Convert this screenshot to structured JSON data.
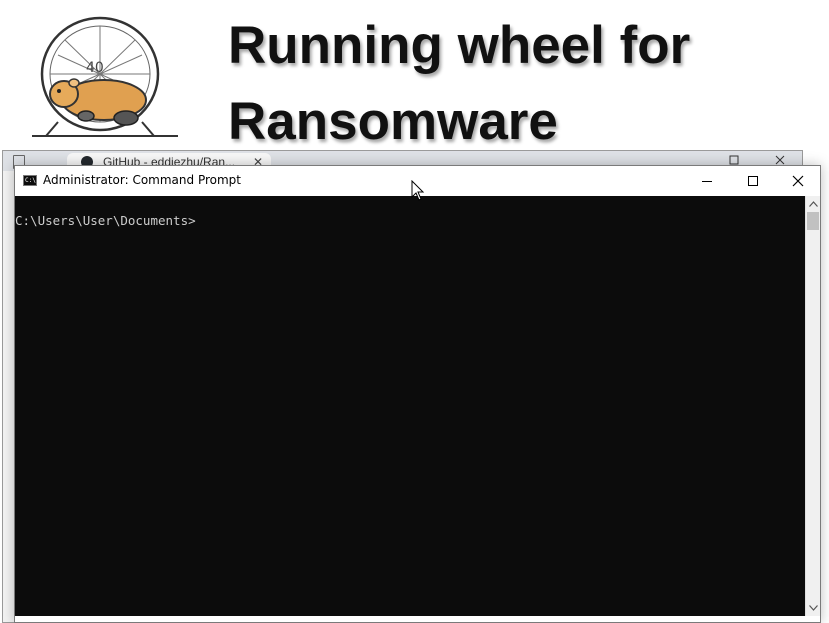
{
  "slide": {
    "title_line1": "Running wheel for",
    "title_line2": "Ransomware"
  },
  "browser": {
    "tab_label": "GitHub - eddiezhu/Ran..."
  },
  "cmd": {
    "title": "Administrator: Command Prompt",
    "icon_text": "C:\\",
    "prompt_line": "C:\\Users\\User\\Documents>"
  },
  "icons": [
    "hamster-wheel-logo",
    "github-icon",
    "close-icon",
    "minimize-icon",
    "maximize-icon",
    "cmd-icon",
    "chevron-up-icon",
    "chevron-down-icon",
    "mouse-cursor-icon"
  ],
  "colors": {
    "console_bg": "#0c0c0c",
    "console_fg": "#cccccc",
    "hamster": "#e0a050"
  }
}
